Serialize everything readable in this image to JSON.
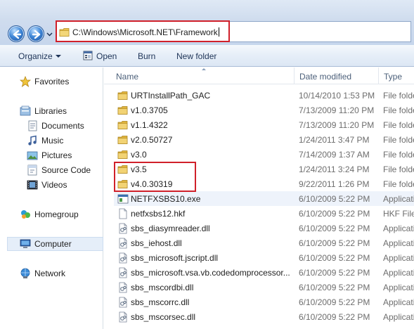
{
  "address": {
    "path": "C:\\Windows\\Microsoft.NET\\Framework"
  },
  "toolbar": {
    "organize": "Organize",
    "open": "Open",
    "burn": "Burn",
    "new_folder": "New folder"
  },
  "nav": {
    "favorites": "Favorites",
    "libraries": "Libraries",
    "documents": "Documents",
    "music": "Music",
    "pictures": "Pictures",
    "source_code": "Source Code",
    "videos": "Videos",
    "homegroup": "Homegroup",
    "computer": "Computer",
    "network": "Network"
  },
  "columns": {
    "name": "Name",
    "date": "Date modified",
    "type": "Type"
  },
  "files": [
    {
      "name": "URTInstallPath_GAC",
      "date": "10/14/2010 1:53 PM",
      "type": "File folder",
      "icon": "folder-icon"
    },
    {
      "name": "v1.0.3705",
      "date": "7/13/2009 11:20 PM",
      "type": "File folder",
      "icon": "folder-icon"
    },
    {
      "name": "v1.1.4322",
      "date": "7/13/2009 11:20 PM",
      "type": "File folder",
      "icon": "folder-icon"
    },
    {
      "name": "v2.0.50727",
      "date": "1/24/2011 3:47 PM",
      "type": "File folder",
      "icon": "folder-icon"
    },
    {
      "name": "v3.0",
      "date": "7/14/2009 1:37 AM",
      "type": "File folder",
      "icon": "folder-icon"
    },
    {
      "name": "v3.5",
      "date": "1/24/2011 3:24 PM",
      "type": "File folder",
      "icon": "folder-icon"
    },
    {
      "name": "v4.0.30319",
      "date": "9/22/2011 1:26 PM",
      "type": "File folder",
      "icon": "folder-icon"
    },
    {
      "name": "NETFXSBS10.exe",
      "date": "6/10/2009 5:22 PM",
      "type": "Application",
      "icon": "exe-icon"
    },
    {
      "name": "netfxsbs12.hkf",
      "date": "6/10/2009 5:22 PM",
      "type": "HKF File",
      "icon": "file-icon"
    },
    {
      "name": "sbs_diasymreader.dll",
      "date": "6/10/2009 5:22 PM",
      "type": "Application extension",
      "icon": "dll-icon"
    },
    {
      "name": "sbs_iehost.dll",
      "date": "6/10/2009 5:22 PM",
      "type": "Application extension",
      "icon": "dll-icon"
    },
    {
      "name": "sbs_microsoft.jscript.dll",
      "date": "6/10/2009 5:22 PM",
      "type": "Application extension",
      "icon": "dll-icon"
    },
    {
      "name": "sbs_microsoft.vsa.vb.codedomprocessor...",
      "date": "6/10/2009 5:22 PM",
      "type": "Application extension",
      "icon": "dll-icon"
    },
    {
      "name": "sbs_mscordbi.dll",
      "date": "6/10/2009 5:22 PM",
      "type": "Application extension",
      "icon": "dll-icon"
    },
    {
      "name": "sbs_mscorrc.dll",
      "date": "6/10/2009 5:22 PM",
      "type": "Application extension",
      "icon": "dll-icon"
    },
    {
      "name": "sbs_mscorsec.dll",
      "date": "6/10/2009 5:22 PM",
      "type": "Application extension",
      "icon": "dll-icon"
    }
  ],
  "selected_file_index": 7,
  "colors": {
    "highlight_box": "#d0202a",
    "folder": "#e8c250",
    "header_text": "#4c607a"
  }
}
